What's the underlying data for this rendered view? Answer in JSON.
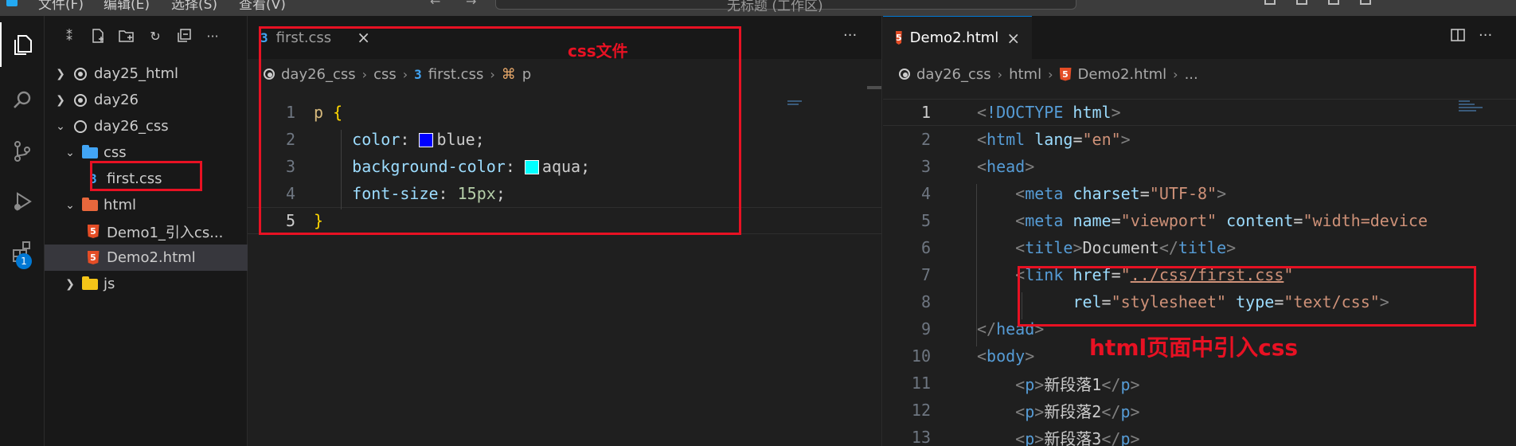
{
  "titlebar": {
    "menu_items": [
      "文件(F)",
      "编辑(E)",
      "选择(S)",
      "查看(V)"
    ],
    "command_center": "无标题 (工作区)"
  },
  "activity_bar": {
    "items": [
      {
        "icon": "files-icon",
        "active": true
      },
      {
        "icon": "search-icon"
      },
      {
        "icon": "source-control-icon"
      },
      {
        "icon": "run-debug-icon"
      },
      {
        "icon": "extensions-icon",
        "badge": "1"
      }
    ]
  },
  "explorer": {
    "tree": [
      {
        "label": "day25_html",
        "kind": "workspace-folder",
        "expanded": false,
        "depth": 0
      },
      {
        "label": "day26",
        "kind": "workspace-folder",
        "expanded": false,
        "depth": 0
      },
      {
        "label": "day26_css",
        "kind": "workspace-folder-open",
        "expanded": true,
        "depth": 0
      },
      {
        "label": "css",
        "kind": "folder-css",
        "expanded": true,
        "depth": 1
      },
      {
        "label": "first.css",
        "kind": "css-file",
        "depth": 2
      },
      {
        "label": "html",
        "kind": "folder-html",
        "expanded": true,
        "depth": 1
      },
      {
        "label": "Demo1_引入cs...",
        "kind": "html-file",
        "depth": 2
      },
      {
        "label": "Demo2.html",
        "kind": "html-file",
        "depth": 2,
        "selected": true
      },
      {
        "label": "js",
        "kind": "folder-js",
        "expanded": false,
        "depth": 1
      }
    ]
  },
  "left_editor": {
    "tab": {
      "label": "first.css",
      "close": "×"
    },
    "breadcrumb": [
      "day26_css",
      "css",
      "first.css",
      "p"
    ],
    "lines": [
      {
        "n": "1",
        "tokens": [
          [
            "t-sel",
            "p"
          ],
          [
            "t-punc",
            " "
          ],
          [
            "t-brace",
            "{"
          ]
        ]
      },
      {
        "n": "2",
        "tokens": [
          [
            "t-punc",
            "    "
          ],
          [
            "t-prop",
            "color"
          ],
          [
            "t-punc",
            ": "
          ],
          [
            "swatch",
            "#0000ff"
          ],
          [
            "t-val",
            "blue"
          ],
          [
            "t-punc",
            ";"
          ]
        ]
      },
      {
        "n": "3",
        "tokens": [
          [
            "t-punc",
            "    "
          ],
          [
            "t-prop",
            "background-color"
          ],
          [
            "t-punc",
            ": "
          ],
          [
            "swatch",
            "#00ffff"
          ],
          [
            "t-val",
            "aqua"
          ],
          [
            "t-punc",
            ";"
          ]
        ]
      },
      {
        "n": "4",
        "tokens": [
          [
            "t-punc",
            "    "
          ],
          [
            "t-prop",
            "font-size"
          ],
          [
            "t-punc",
            ": "
          ],
          [
            "t-num",
            "15px"
          ],
          [
            "t-punc",
            ";"
          ]
        ]
      },
      {
        "n": "5",
        "tokens": [
          [
            "t-brace",
            "}"
          ]
        ],
        "current": true
      }
    ],
    "annotation": "css文件"
  },
  "right_editor": {
    "tab": {
      "label": "Demo2.html",
      "close": "×"
    },
    "breadcrumb": [
      "day26_css",
      "html",
      "Demo2.html",
      "..."
    ],
    "lines": [
      {
        "n": "1",
        "current": true,
        "tokens": [
          [
            "t-br",
            "<"
          ],
          [
            "t-tag",
            "!DOCTYPE"
          ],
          [
            "t-text",
            " "
          ],
          [
            "t-attr",
            "html"
          ],
          [
            "t-br",
            ">"
          ]
        ]
      },
      {
        "n": "2",
        "tokens": [
          [
            "t-br",
            "<"
          ],
          [
            "t-tag",
            "html"
          ],
          [
            "t-text",
            " "
          ],
          [
            "t-attr",
            "lang"
          ],
          [
            "t-text",
            "="
          ],
          [
            "t-str",
            "\"en\""
          ],
          [
            "t-br",
            ">"
          ]
        ]
      },
      {
        "n": "3",
        "tokens": [
          [
            "t-br",
            "<"
          ],
          [
            "t-tag",
            "head"
          ],
          [
            "t-br",
            ">"
          ]
        ]
      },
      {
        "n": "4",
        "tokens": [
          [
            "t-text",
            "    "
          ],
          [
            "t-br",
            "<"
          ],
          [
            "t-tag",
            "meta"
          ],
          [
            "t-text",
            " "
          ],
          [
            "t-attr",
            "charset"
          ],
          [
            "t-text",
            "="
          ],
          [
            "t-str",
            "\"UTF-8\""
          ],
          [
            "t-br",
            ">"
          ]
        ]
      },
      {
        "n": "5",
        "tokens": [
          [
            "t-text",
            "    "
          ],
          [
            "t-br",
            "<"
          ],
          [
            "t-tag",
            "meta"
          ],
          [
            "t-text",
            " "
          ],
          [
            "t-attr",
            "name"
          ],
          [
            "t-text",
            "="
          ],
          [
            "t-str",
            "\"viewport\""
          ],
          [
            "t-text",
            " "
          ],
          [
            "t-attr",
            "content"
          ],
          [
            "t-text",
            "="
          ],
          [
            "t-str",
            "\"width=device"
          ]
        ]
      },
      {
        "n": "6",
        "tokens": [
          [
            "t-text",
            "    "
          ],
          [
            "t-br",
            "<"
          ],
          [
            "t-tag",
            "title"
          ],
          [
            "t-br",
            ">"
          ],
          [
            "t-text",
            "Document"
          ],
          [
            "t-br",
            "</"
          ],
          [
            "t-tag",
            "title"
          ],
          [
            "t-br",
            ">"
          ]
        ]
      },
      {
        "n": "7",
        "tokens": [
          [
            "t-text",
            "    "
          ],
          [
            "t-br",
            "<"
          ],
          [
            "t-tag",
            "link"
          ],
          [
            "t-text",
            " "
          ],
          [
            "t-attr",
            "href"
          ],
          [
            "t-text",
            "="
          ],
          [
            "t-str",
            "\""
          ],
          [
            "t-str-u",
            "../css/first.css"
          ],
          [
            "t-str",
            "\""
          ]
        ]
      },
      {
        "n": "8",
        "tokens": [
          [
            "t-text",
            "          "
          ],
          [
            "t-attr",
            "rel"
          ],
          [
            "t-text",
            "="
          ],
          [
            "t-str",
            "\"stylesheet\""
          ],
          [
            "t-text",
            " "
          ],
          [
            "t-attr",
            "type"
          ],
          [
            "t-text",
            "="
          ],
          [
            "t-str",
            "\"text/css\""
          ],
          [
            "t-br",
            ">"
          ]
        ]
      },
      {
        "n": "9",
        "tokens": [
          [
            "t-br",
            "</"
          ],
          [
            "t-tag",
            "head"
          ],
          [
            "t-br",
            ">"
          ]
        ]
      },
      {
        "n": "10",
        "tokens": [
          [
            "t-br",
            "<"
          ],
          [
            "t-tag",
            "body"
          ],
          [
            "t-br",
            ">"
          ]
        ]
      },
      {
        "n": "11",
        "tokens": [
          [
            "t-text",
            "    "
          ],
          [
            "t-br",
            "<"
          ],
          [
            "t-tag",
            "p"
          ],
          [
            "t-br",
            ">"
          ],
          [
            "t-text",
            "新段落1"
          ],
          [
            "t-br",
            "</"
          ],
          [
            "t-tag",
            "p"
          ],
          [
            "t-br",
            ">"
          ]
        ]
      },
      {
        "n": "12",
        "tokens": [
          [
            "t-text",
            "    "
          ],
          [
            "t-br",
            "<"
          ],
          [
            "t-tag",
            "p"
          ],
          [
            "t-br",
            ">"
          ],
          [
            "t-text",
            "新段落2"
          ],
          [
            "t-br",
            "</"
          ],
          [
            "t-tag",
            "p"
          ],
          [
            "t-br",
            ">"
          ]
        ]
      },
      {
        "n": "13",
        "tokens": [
          [
            "t-text",
            "    "
          ],
          [
            "t-br",
            "<"
          ],
          [
            "t-tag",
            "p"
          ],
          [
            "t-br",
            ">"
          ],
          [
            "t-text",
            "新段落3"
          ],
          [
            "t-br",
            "</"
          ],
          [
            "t-tag",
            "p"
          ],
          [
            "t-br",
            ">"
          ]
        ]
      }
    ],
    "annotation": "html页面中引入css"
  },
  "colors": {
    "accent": "#0078d4",
    "annotation_red": "#e81123",
    "editor_bg": "#1f1f1f",
    "sidebar_bg": "#181818"
  }
}
